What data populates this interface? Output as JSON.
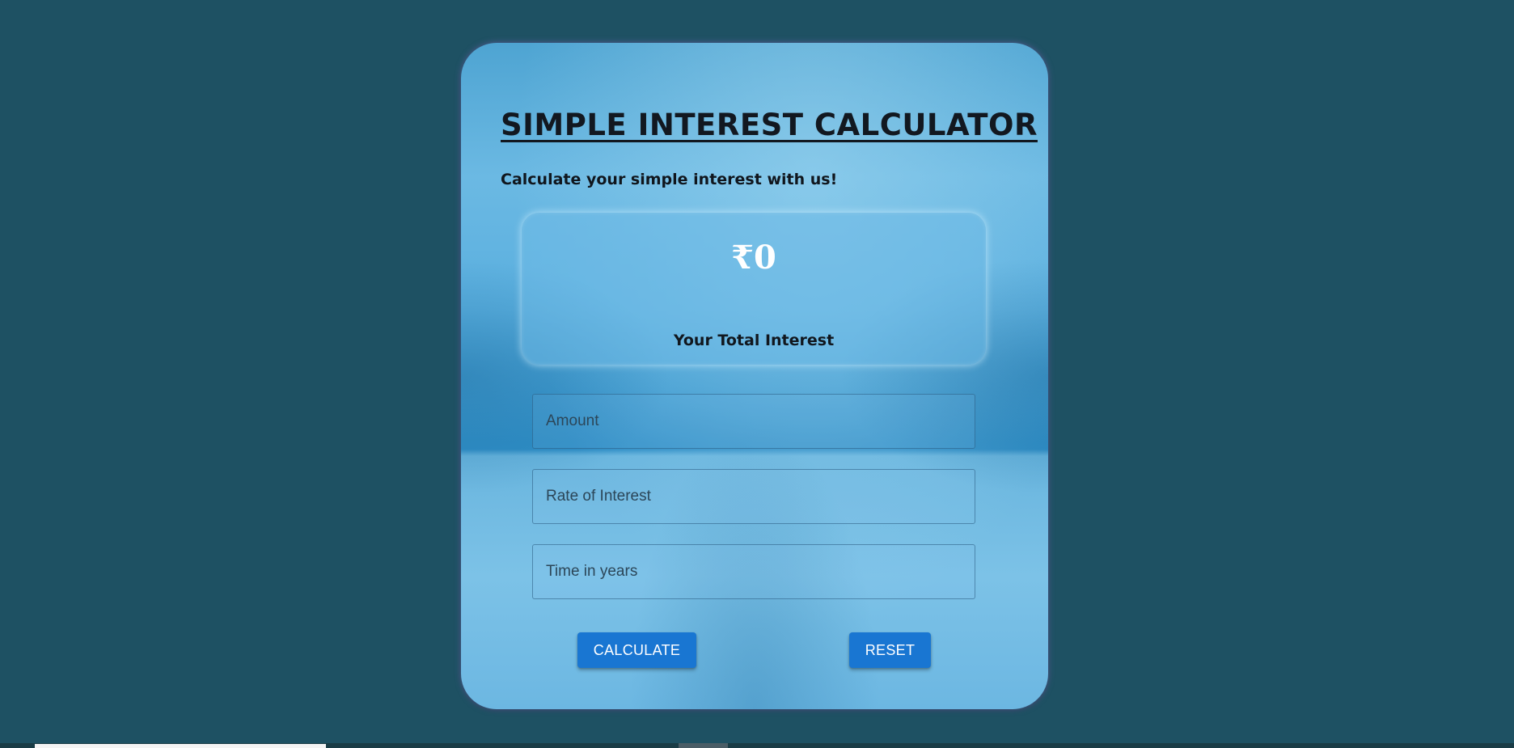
{
  "card": {
    "title": "SIMPLE INTEREST CALCULATOR",
    "subtitle": "Calculate your simple interest with us!"
  },
  "result": {
    "value": "₹0",
    "label": "Your Total Interest"
  },
  "form": {
    "amount_placeholder": "Amount",
    "rate_placeholder": "Rate of Interest",
    "time_placeholder": "Time in years"
  },
  "buttons": {
    "calculate_label": "CALCULATE",
    "reset_label": "RESET"
  },
  "colors": {
    "page_background": "#1e5163",
    "button": "#1976d2",
    "title_text": "#121820"
  }
}
